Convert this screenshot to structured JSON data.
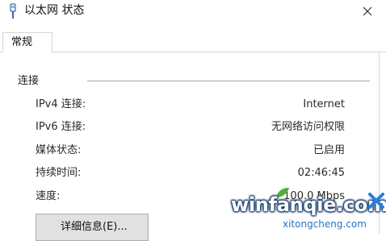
{
  "window": {
    "title": "以太网 状态"
  },
  "tabs": [
    {
      "label": "常规"
    }
  ],
  "connection": {
    "title": "连接",
    "rows": [
      {
        "label": "IPv4 连接:",
        "value": "Internet"
      },
      {
        "label": "IPv6 连接:",
        "value": "无网络访问权限"
      },
      {
        "label": "媒体状态:",
        "value": "已启用"
      },
      {
        "label": "持续时间:",
        "value": "02:46:45"
      },
      {
        "label": "速度:",
        "value": "100.0 Mbps"
      }
    ]
  },
  "buttons": {
    "details": "详细信息(E)..."
  },
  "watermark": {
    "main": "winfanqie.com",
    "sub": "xitongcheng.com"
  }
}
